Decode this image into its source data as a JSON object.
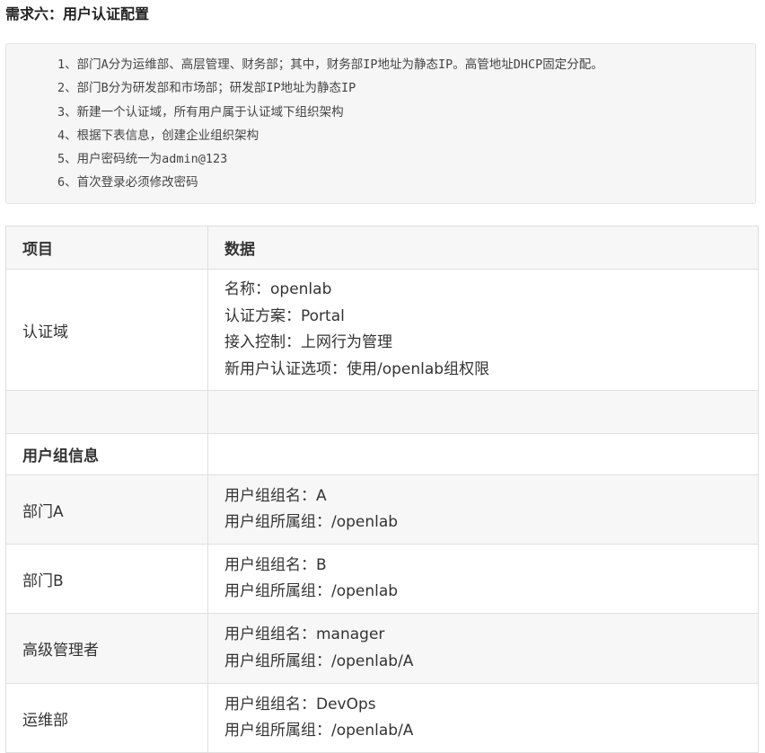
{
  "header": {
    "title": "需求六：用户认证配置"
  },
  "requirements": [
    "1、部门A分为运维部、高层管理、财务部；其中，财务部IP地址为静态IP。高管地址DHCP固定分配。",
    "2、部门B分为研发部和市场部；研发部IP地址为静态IP",
    "3、新建一个认证域，所有用户属于认证域下组织架构",
    "4、根据下表信息，创建企业组织架构",
    "5、用户密码统一为admin@123",
    "6、首次登录必须修改密码"
  ],
  "table": {
    "headers": [
      "项目",
      "数据"
    ],
    "auth_domain": {
      "label": "认证域",
      "lines": [
        "名称：openlab",
        "认证方案：Portal",
        "接入控制：上网行为管理",
        "新用户认证选项：使用/openlab组权限"
      ]
    },
    "group_info_label": "用户组信息",
    "groups": [
      {
        "label": "部门A",
        "lines": [
          "用户组组名：A",
          "用户组所属组：/openlab"
        ]
      },
      {
        "label": "部门B",
        "lines": [
          "用户组组名：B",
          "用户组所属组：/openlab"
        ]
      },
      {
        "label": "高级管理者",
        "lines": [
          "用户组组名：manager",
          "用户组所属组：/openlab/A"
        ]
      },
      {
        "label": "运维部",
        "lines": [
          "用户组组名：DevOps",
          "用户组所属组：/openlab/A"
        ]
      }
    ]
  }
}
